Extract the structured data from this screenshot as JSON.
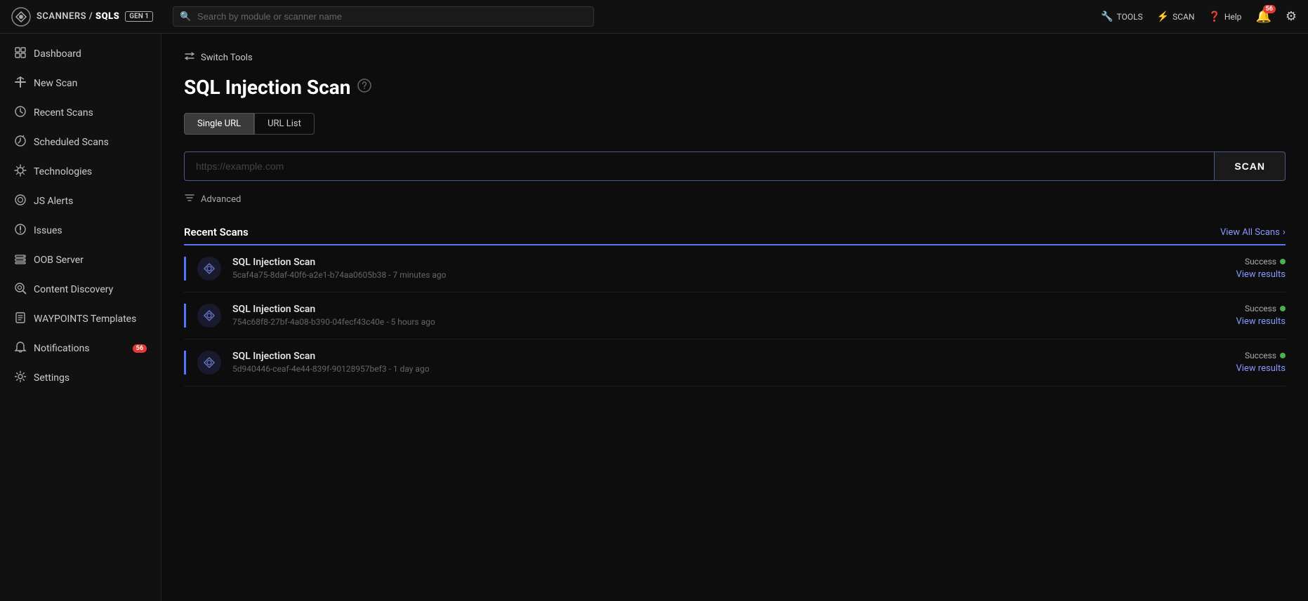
{
  "navbar": {
    "brand": {
      "name": "SCANNERS / SQLS",
      "badge": "GEN 1"
    },
    "search_placeholder": "Search by module or scanner name",
    "actions": {
      "tools": "TOOLS",
      "scan": "SCAN",
      "help": "Help"
    },
    "notification_count": "56"
  },
  "sidebar": {
    "items": [
      {
        "id": "dashboard",
        "label": "Dashboard",
        "icon": "⬡"
      },
      {
        "id": "new-scan",
        "label": "New Scan",
        "icon": "⚡"
      },
      {
        "id": "recent-scans",
        "label": "Recent Scans",
        "icon": "🕐"
      },
      {
        "id": "scheduled-scans",
        "label": "Scheduled Scans",
        "icon": "🕑"
      },
      {
        "id": "technologies",
        "label": "Technologies",
        "icon": "✺"
      },
      {
        "id": "js-alerts",
        "label": "JS Alerts",
        "icon": "◎"
      },
      {
        "id": "issues",
        "label": "Issues",
        "icon": "⚙"
      },
      {
        "id": "oob-server",
        "label": "OOB Server",
        "icon": "☰"
      },
      {
        "id": "content-discovery",
        "label": "Content Discovery",
        "icon": "◉"
      },
      {
        "id": "waypoints-templates",
        "label": "WAYPOINTS Templates",
        "icon": "📄"
      },
      {
        "id": "notifications",
        "label": "Notifications",
        "icon": "🔔",
        "badge": "56"
      },
      {
        "id": "settings",
        "label": "Settings",
        "icon": "⚙"
      }
    ]
  },
  "main": {
    "switch_tools_label": "Switch Tools",
    "page_title": "SQL Injection Scan",
    "tabs": [
      {
        "id": "single-url",
        "label": "Single URL",
        "active": true
      },
      {
        "id": "url-list",
        "label": "URL List",
        "active": false
      }
    ],
    "url_input_placeholder": "https://example.com",
    "scan_button_label": "SCAN",
    "advanced_label": "Advanced",
    "recent_scans_title": "Recent Scans",
    "view_all_label": "View All Scans",
    "scans": [
      {
        "name": "SQL Injection Scan",
        "id": "5caf4a75-8daf-40f6-a2e1-b74aa0605b38",
        "time": "7 minutes ago",
        "status": "Success",
        "view_results": "View results"
      },
      {
        "name": "SQL Injection Scan",
        "id": "754c68f8-27bf-4a08-b390-04fecf43c40e",
        "time": "5 hours ago",
        "status": "Success",
        "view_results": "View results"
      },
      {
        "name": "SQL Injection Scan",
        "id": "5d940446-ceaf-4e44-839f-90128957bef3",
        "time": "1 day ago",
        "status": "Success",
        "view_results": "View results"
      }
    ]
  }
}
